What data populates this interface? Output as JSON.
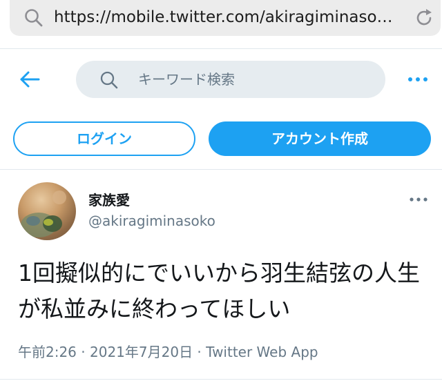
{
  "browser": {
    "url": "https://mobile.twitter.com/akiragiminaso…"
  },
  "header": {
    "search_placeholder": "キーワード検索"
  },
  "auth": {
    "login_label": "ログイン",
    "signup_label": "アカウント作成"
  },
  "tweet": {
    "display_name": "家族愛",
    "handle": "@akiragiminasoko",
    "text": "1回擬似的にでいいから羽生結弦の人生が私並みに終わってほしい",
    "time": "午前2:26",
    "date": "2021年7月20日",
    "source": "Twitter Web App",
    "separator": " · "
  },
  "colors": {
    "accent": "#1da1f2",
    "secondary_text": "#657786",
    "search_bg": "#e6ecf0"
  },
  "icons": [
    "search-icon",
    "reload-icon",
    "back-arrow-icon",
    "more-icon"
  ]
}
